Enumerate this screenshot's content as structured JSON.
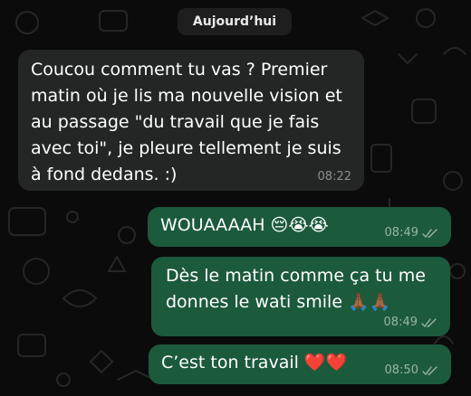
{
  "date_label": "Aujourd’hui",
  "messages": [
    {
      "direction": "incoming",
      "text": "Coucou comment tu vas ? Premier matin où je lis ma nouvelle vision et au passage \"du travail que je fais avec toi\", je pleure tellement je suis à fond dedans. :)",
      "time": "08:22"
    },
    {
      "direction": "outgoing",
      "text": "WOUAAAAH 😔😭😭",
      "time": "08:49",
      "status": "read-double-check-icon"
    },
    {
      "direction": "outgoing",
      "text": "Dès le matin comme ça tu me donnes le wati smile 🙏🏾🙏🏾",
      "time": "08:49",
      "status": "read-double-check-icon"
    },
    {
      "direction": "outgoing",
      "text": "C’est ton travail ❤️❤️",
      "time": "08:50",
      "status": "read-double-check-icon"
    }
  ],
  "colors": {
    "background": "#0b0b0b",
    "incoming_bubble": "#242626",
    "outgoing_bubble": "#1c5a3c",
    "date_pill": "#1e1e1e"
  }
}
